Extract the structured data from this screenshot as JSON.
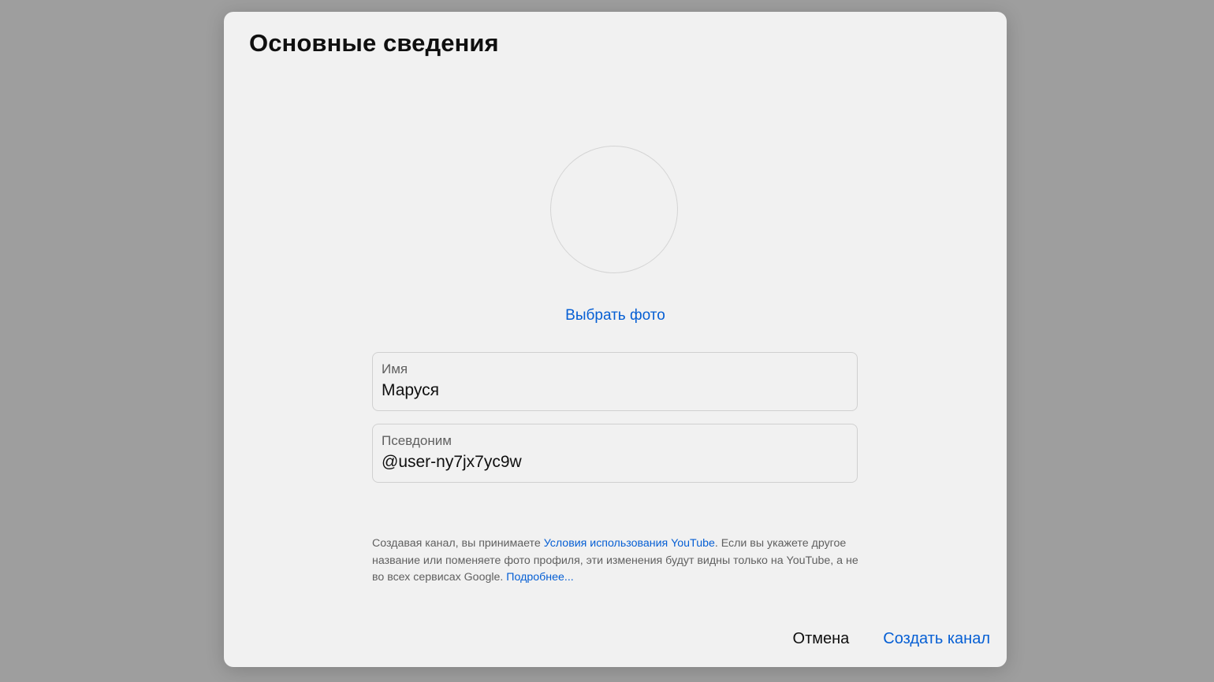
{
  "dialog": {
    "title": "Основные сведения",
    "pick_photo_label": "Выбрать фото",
    "fields": {
      "name": {
        "label": "Имя",
        "value": "Маруся"
      },
      "handle": {
        "label": "Псевдоним",
        "value": "@user-ny7jx7yc9w"
      }
    },
    "legal": {
      "text_before_terms": "Создавая канал, вы принимаете ",
      "terms_link": "Условия использования YouTube",
      "text_after_terms": ". Если вы укажете другое название или поменяете фото профиля, эти изменения будут видны только на YouTube, а не во всех сервисах Google. ",
      "more_link": "Подробнее..."
    },
    "actions": {
      "cancel_label": "Отмена",
      "create_label": "Создать канал"
    }
  },
  "colors": {
    "accent": "#065fd4",
    "backdrop": "#9e9e9e",
    "dialog_bg": "#f1f1f1",
    "text_primary": "#0f0f0f",
    "text_secondary": "#606060"
  }
}
